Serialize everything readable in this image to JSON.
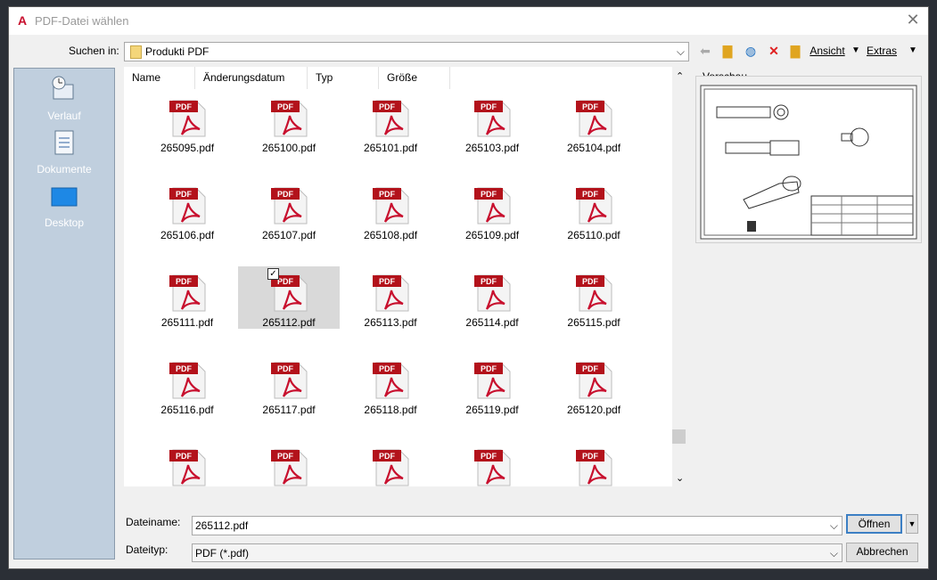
{
  "window": {
    "title": "PDF-Datei wählen",
    "app_icon": "A",
    "close_glyph": "✕"
  },
  "toolbar": {
    "suchen_label": "Suchen in:",
    "folder": "Produkti PDF",
    "ansicht": "Ansicht",
    "extras": "Extras"
  },
  "sidebar": {
    "items": [
      {
        "label": "Verlauf",
        "icon": "history-icon"
      },
      {
        "label": "Dokumente",
        "icon": "documents-icon"
      },
      {
        "label": "Desktop",
        "icon": "desktop-icon"
      }
    ]
  },
  "columns": [
    "Name",
    "Änderungsdatum",
    "Typ",
    "Größe"
  ],
  "files": [
    "265095.pdf",
    "265100.pdf",
    "265101.pdf",
    "265103.pdf",
    "265104.pdf",
    "265106.pdf",
    "265107.pdf",
    "265108.pdf",
    "265109.pdf",
    "265110.pdf",
    "265111.pdf",
    "265112.pdf",
    "265113.pdf",
    "265114.pdf",
    "265115.pdf",
    "265116.pdf",
    "265117.pdf",
    "265118.pdf",
    "265119.pdf",
    "265120.pdf",
    "",
    "",
    "",
    "",
    ""
  ],
  "selected_file": "265112.pdf",
  "pdf_badge": "PDF",
  "preview_label": "Vorschau",
  "bottom": {
    "dateiname_label": "Dateiname:",
    "dateiname_value": "265112.pdf",
    "dateityp_label": "Dateityp:",
    "dateityp_value": "PDF (*.pdf)",
    "open_label": "Öffnen",
    "cancel_label": "Abbrechen"
  },
  "colors": {
    "accent": "#c8102e",
    "sidebar": "#c0cfde",
    "selection": "#d9d9d9"
  }
}
